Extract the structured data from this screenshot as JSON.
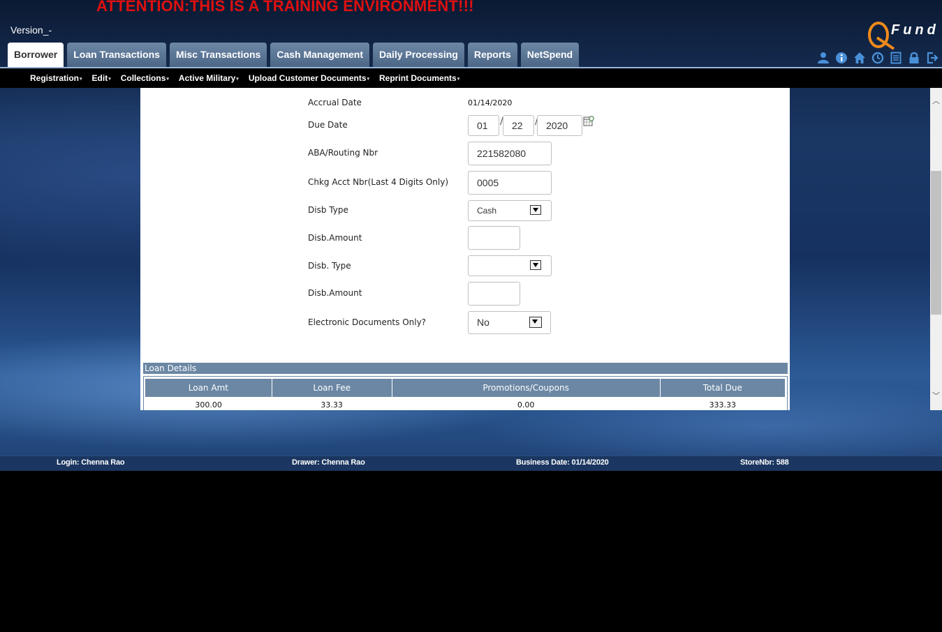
{
  "banner": {
    "attention": "ATTENTION:THIS IS A TRAINING ENVIRONMENT!!!",
    "version": "Version_-",
    "logo_text": "Fund"
  },
  "tabs": [
    {
      "label": "Borrower",
      "active": true
    },
    {
      "label": "Loan Transactions"
    },
    {
      "label": "Misc Transactions"
    },
    {
      "label": "Cash Management"
    },
    {
      "label": "Daily Processing"
    },
    {
      "label": "Reports"
    },
    {
      "label": "NetSpend"
    }
  ],
  "header_icons": [
    "user-icon",
    "info-icon",
    "home-icon",
    "clock-icon",
    "list-icon",
    "lock-icon",
    "logout-icon"
  ],
  "subnav": [
    "Registration",
    "Edit",
    "Collections",
    "Active Military",
    "Upload Customer Documents",
    "Reprint Documents"
  ],
  "form": {
    "accrual_date_label": "Accrual Date",
    "accrual_date_value": "01/14/2020",
    "due_date_label": "Due Date",
    "due_month": "01",
    "due_day": "22",
    "due_year": "2020",
    "aba_label": "ABA/Routing Nbr",
    "aba_value": "221582080",
    "chkg_label": "Chkg Acct Nbr(Last 4 Digits Only)",
    "chkg_value": "0005",
    "disb_type_label": "Disb Type",
    "disb_type_value": "Cash",
    "disb_amount_label": "Disb.Amount",
    "disb_amount_value": "",
    "disb_type2_label": "Disb. Type",
    "disb_type2_value": "",
    "disb_amount2_label": "Disb.Amount",
    "disb_amount2_value": "",
    "edocs_label": "Electronic Documents Only?",
    "edocs_value": "No"
  },
  "loan_details": {
    "title": "Loan Details",
    "headers": [
      "Loan Amt",
      "Loan Fee",
      "Promotions/Coupons",
      "Total Due"
    ],
    "row": [
      "300.00",
      "33.33",
      "0.00",
      "333.33"
    ]
  },
  "footer": {
    "login": "Login: Chenna Rao",
    "drawer": "Drawer: Chenna Rao",
    "business_date": "Business Date: 01/14/2020",
    "store": "StoreNbr: 588"
  },
  "colors": {
    "attention": "#e01010",
    "tab_bg": "#5a7595",
    "table_header": "#6b87a4",
    "footer_bg": "#1b3660"
  }
}
